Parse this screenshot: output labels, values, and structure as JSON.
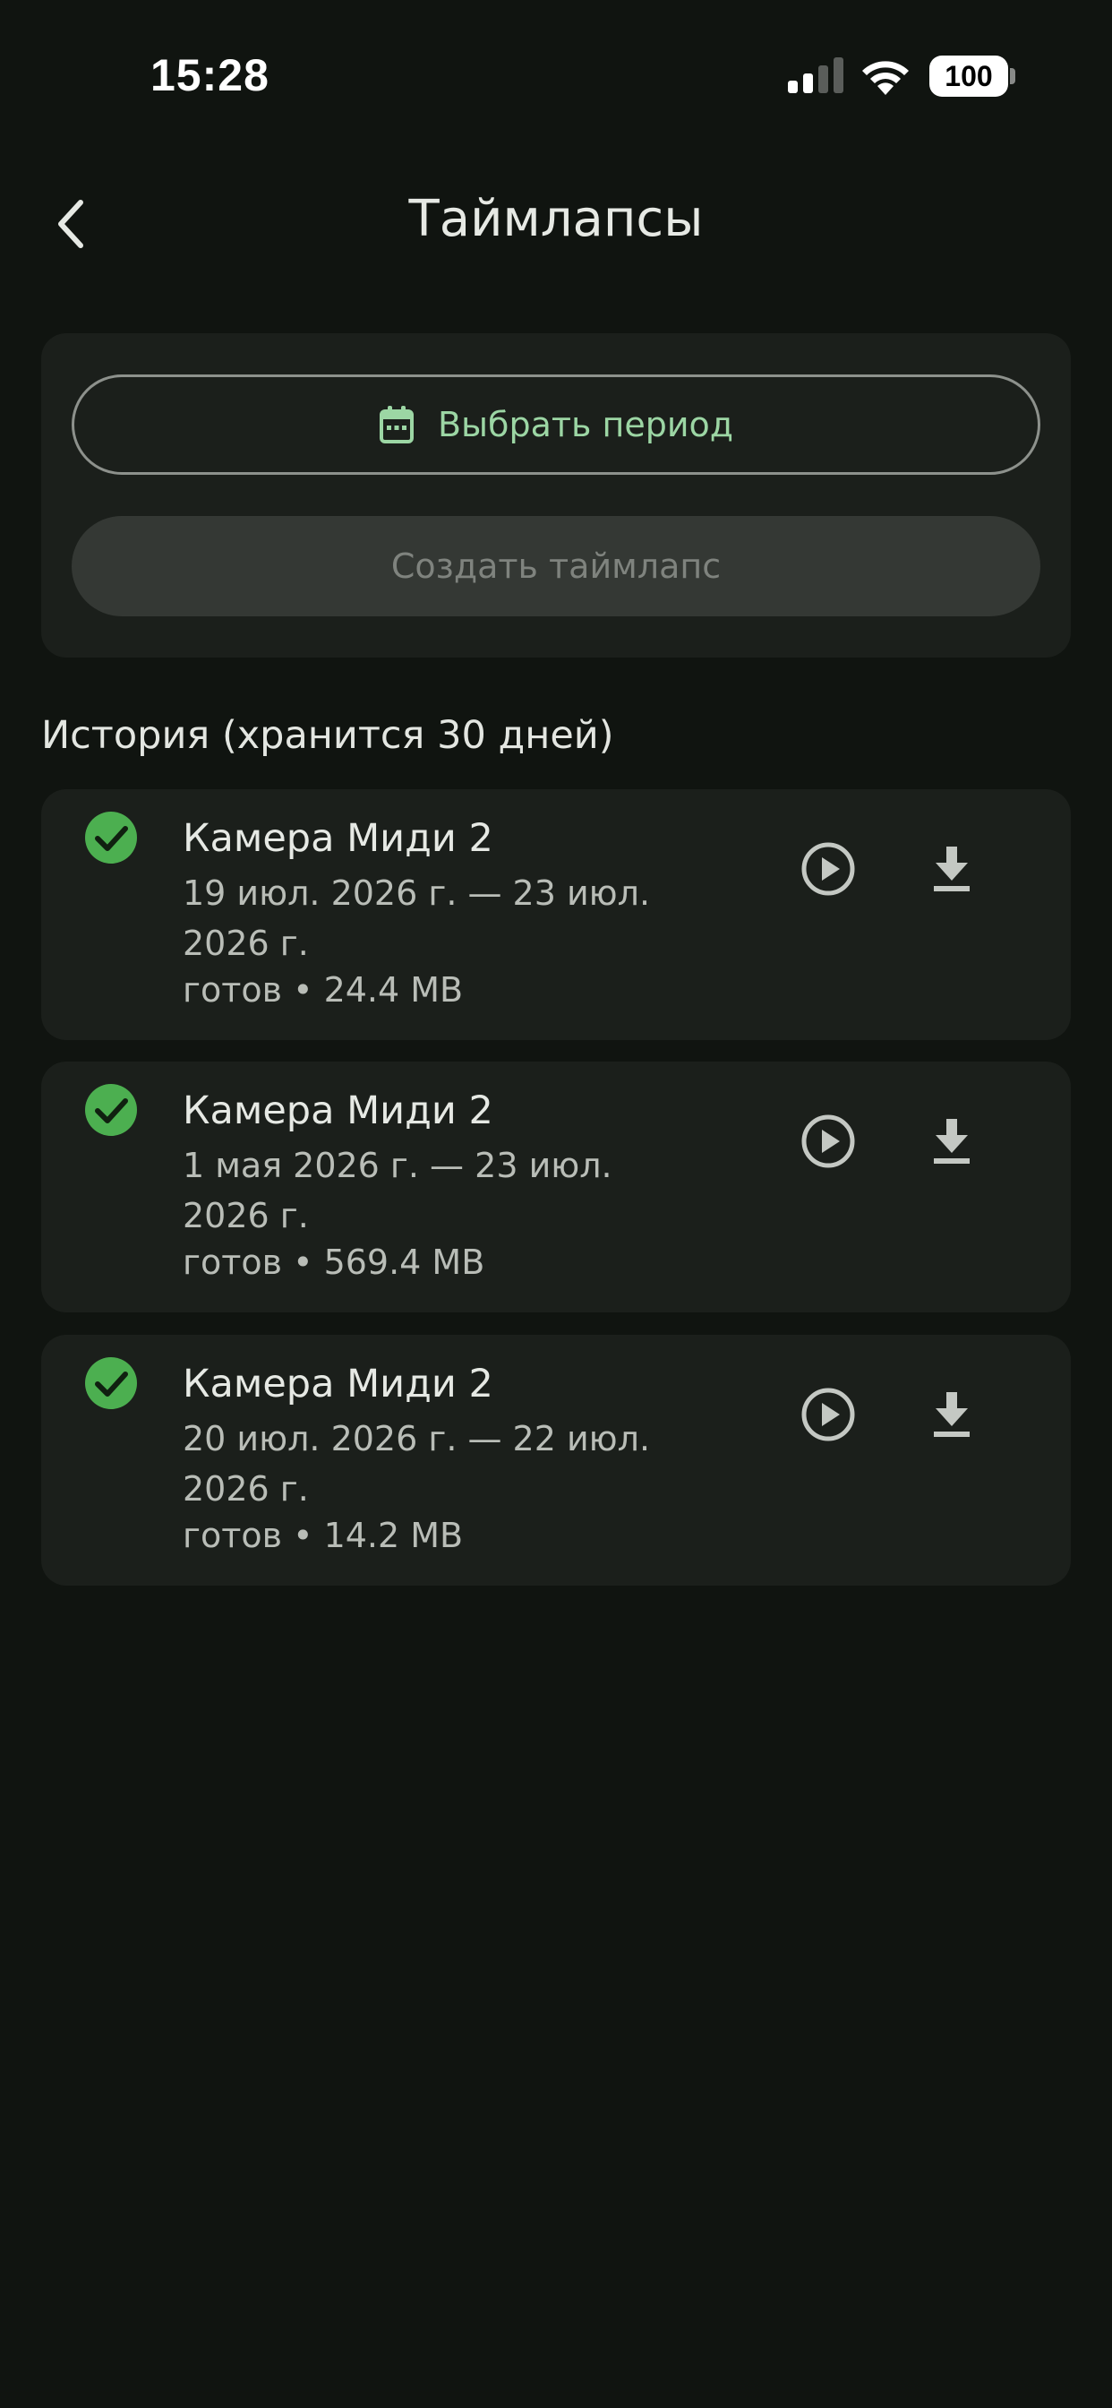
{
  "status_bar": {
    "time": "15:28",
    "battery": "100",
    "icons": [
      "signal-icon",
      "wifi-icon",
      "battery-icon"
    ]
  },
  "header": {
    "title": "Таймлапсы",
    "back_icon": "chevron-left-icon"
  },
  "actions": {
    "select_period_label": "Выбрать период",
    "select_period_icon": "calendar-icon",
    "create_label": "Создать таймлапс"
  },
  "history": {
    "heading": "История (хранится 30 дней)",
    "items": [
      {
        "title": "Камера Миди 2",
        "period": "19 июл. 2026 г. — 23 июл. 2026 г.",
        "status": "готов • 24.4 MB"
      },
      {
        "title": "Камера Миди 2",
        "period": "1 мая 2026 г. — 23 июл. 2026 г.",
        "status": "готов • 569.4 MB"
      },
      {
        "title": "Камера Миди 2",
        "period": "20 июл. 2026 г. — 22 июл. 2026 г.",
        "status": "готов • 14.2 MB"
      }
    ]
  },
  "colors": {
    "background": "#101410",
    "card": "#1b1f1b",
    "accent": "#9cd6a4",
    "success": "#4caf50"
  }
}
